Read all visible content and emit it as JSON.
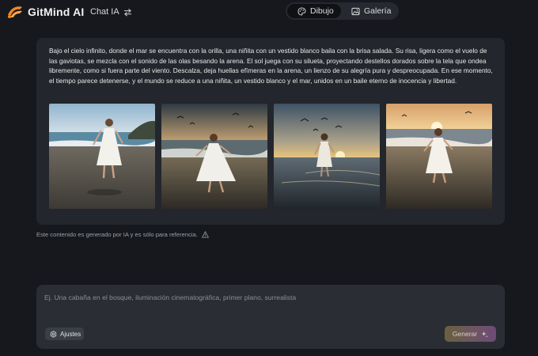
{
  "app": {
    "name": "GitMind AI",
    "brand_color": "#f08a24"
  },
  "nav": {
    "chat_label": "Chat IA"
  },
  "mode_switch": {
    "tabs": [
      {
        "label": "Dibujo",
        "icon": "palette-icon",
        "active": true
      },
      {
        "label": "Galería",
        "icon": "gallery-icon",
        "active": false
      }
    ]
  },
  "result": {
    "text": "Bajo el cielo infinito, donde el mar se encuentra con la orilla, una niñita con un vestido blanco baila con la brisa salada. Su risa, ligera como el vuelo de las gaviotas, se mezcla con el sonido de las olas besando la arena. El sol juega con su silueta, proyectando destellos dorados sobre la tela que ondea libremente, como si fuera parte del viento. Descalza, deja huellas efímeras en la arena, un lienzo de su alegría pura y despreocupada. En ese momento, el tiempo parece detenerse, y el mundo se reduce a una niñita, un vestido blanco y el mar, unidos en un baile eterno de inocencia y libertad.",
    "images": [
      {
        "name": "generated-image-1"
      },
      {
        "name": "generated-image-2"
      },
      {
        "name": "generated-image-3"
      },
      {
        "name": "generated-image-4"
      }
    ]
  },
  "disclaimer": "Este contenido es generado por IA y es sólo para referencia.",
  "prompt": {
    "placeholder": "Ej. Una cabaña en el bosque, iluminación cinematográfica, primer plano, surrealista",
    "value": "",
    "settings_label": "Ajustes",
    "submit_label": "Generar"
  }
}
